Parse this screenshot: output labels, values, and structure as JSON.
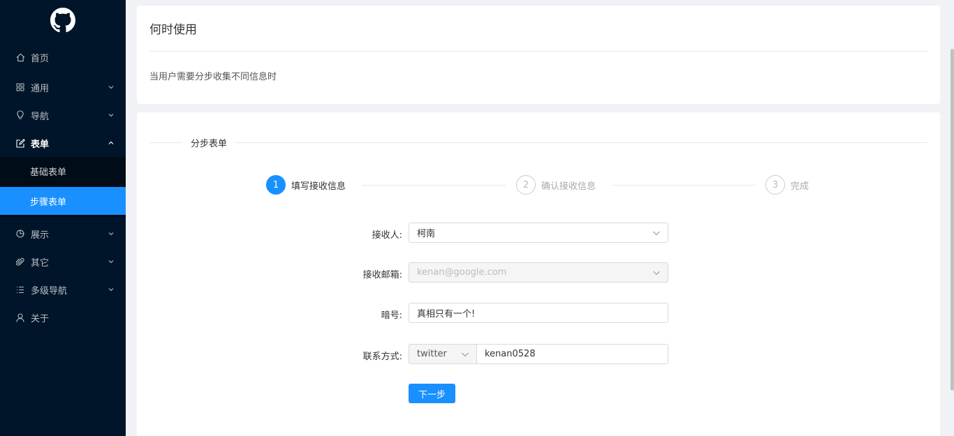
{
  "sidebar": {
    "logo_icon": "github-icon",
    "items": [
      {
        "label": "首页",
        "icon": "home-icon"
      },
      {
        "label": "通用",
        "icon": "grid-icon"
      },
      {
        "label": "导航",
        "icon": "bulb-icon"
      },
      {
        "label": "表单",
        "icon": "edit-icon"
      },
      {
        "label": "展示",
        "icon": "pie-chart-icon"
      },
      {
        "label": "其它",
        "icon": "paperclip-icon"
      },
      {
        "label": "多级导航",
        "icon": "list-icon"
      },
      {
        "label": "关于",
        "icon": "user-icon"
      }
    ],
    "submenu": [
      {
        "label": "基础表单"
      },
      {
        "label": "步骤表单"
      }
    ],
    "active_color": "#1890ff",
    "bg_color": "#001529"
  },
  "intro": {
    "title": "何时使用",
    "description": "当用户需要分步收集不同信息时"
  },
  "form_card": {
    "section_title": "分步表单",
    "steps": [
      {
        "number": "1",
        "label": "填写接收信息",
        "status": "active"
      },
      {
        "number": "2",
        "label": "确认接收信息",
        "status": "wait"
      },
      {
        "number": "3",
        "label": "完成",
        "status": "wait"
      }
    ],
    "fields": {
      "receiver": {
        "label": "接收人:",
        "value": "柯南"
      },
      "email": {
        "label": "接收邮箱:",
        "value": "kenan@google.com"
      },
      "code": {
        "label": "暗号:",
        "value": "真相只有一个!"
      },
      "contact": {
        "label": "联系方式:",
        "type": "twitter",
        "value": "kenan0528"
      }
    },
    "next_button": "下一步"
  }
}
